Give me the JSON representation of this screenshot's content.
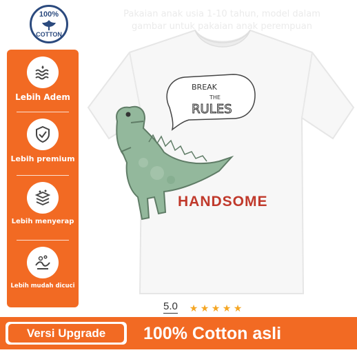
{
  "top_banner": {
    "text": "Pakaian anak usia 1-10 tahun, model dalam\ngambar untuk pakaian anak perempuan"
  },
  "badge": {
    "percent": "100%",
    "word": "COTTON"
  },
  "sidebar": {
    "features": [
      {
        "label": "Lebih Adem",
        "icon": "waves-icon"
      },
      {
        "label": "Lebih premium",
        "icon": "shield-check-icon"
      },
      {
        "label": "Lebih menyerap",
        "icon": "fabric-layers-icon"
      },
      {
        "label": "Lebih mudah dicuci",
        "icon": "washing-icon"
      }
    ]
  },
  "product": {
    "speech_text": [
      "BREAK",
      "THE",
      "RULES"
    ],
    "print_text": "HANDSOME",
    "image": "dinosaur-tshirt-icon"
  },
  "rating": {
    "value": "5.0",
    "stars": 5
  },
  "bottom_banner": {
    "version_label": "Versi Upgrade",
    "cotton_label": "100% Cotton asli"
  },
  "colors": {
    "accent": "#f26a23",
    "badge_blue": "#2b4a7e",
    "star": "#f5a623",
    "print_red": "#c0392b",
    "dino_green": "#8fb59a"
  }
}
